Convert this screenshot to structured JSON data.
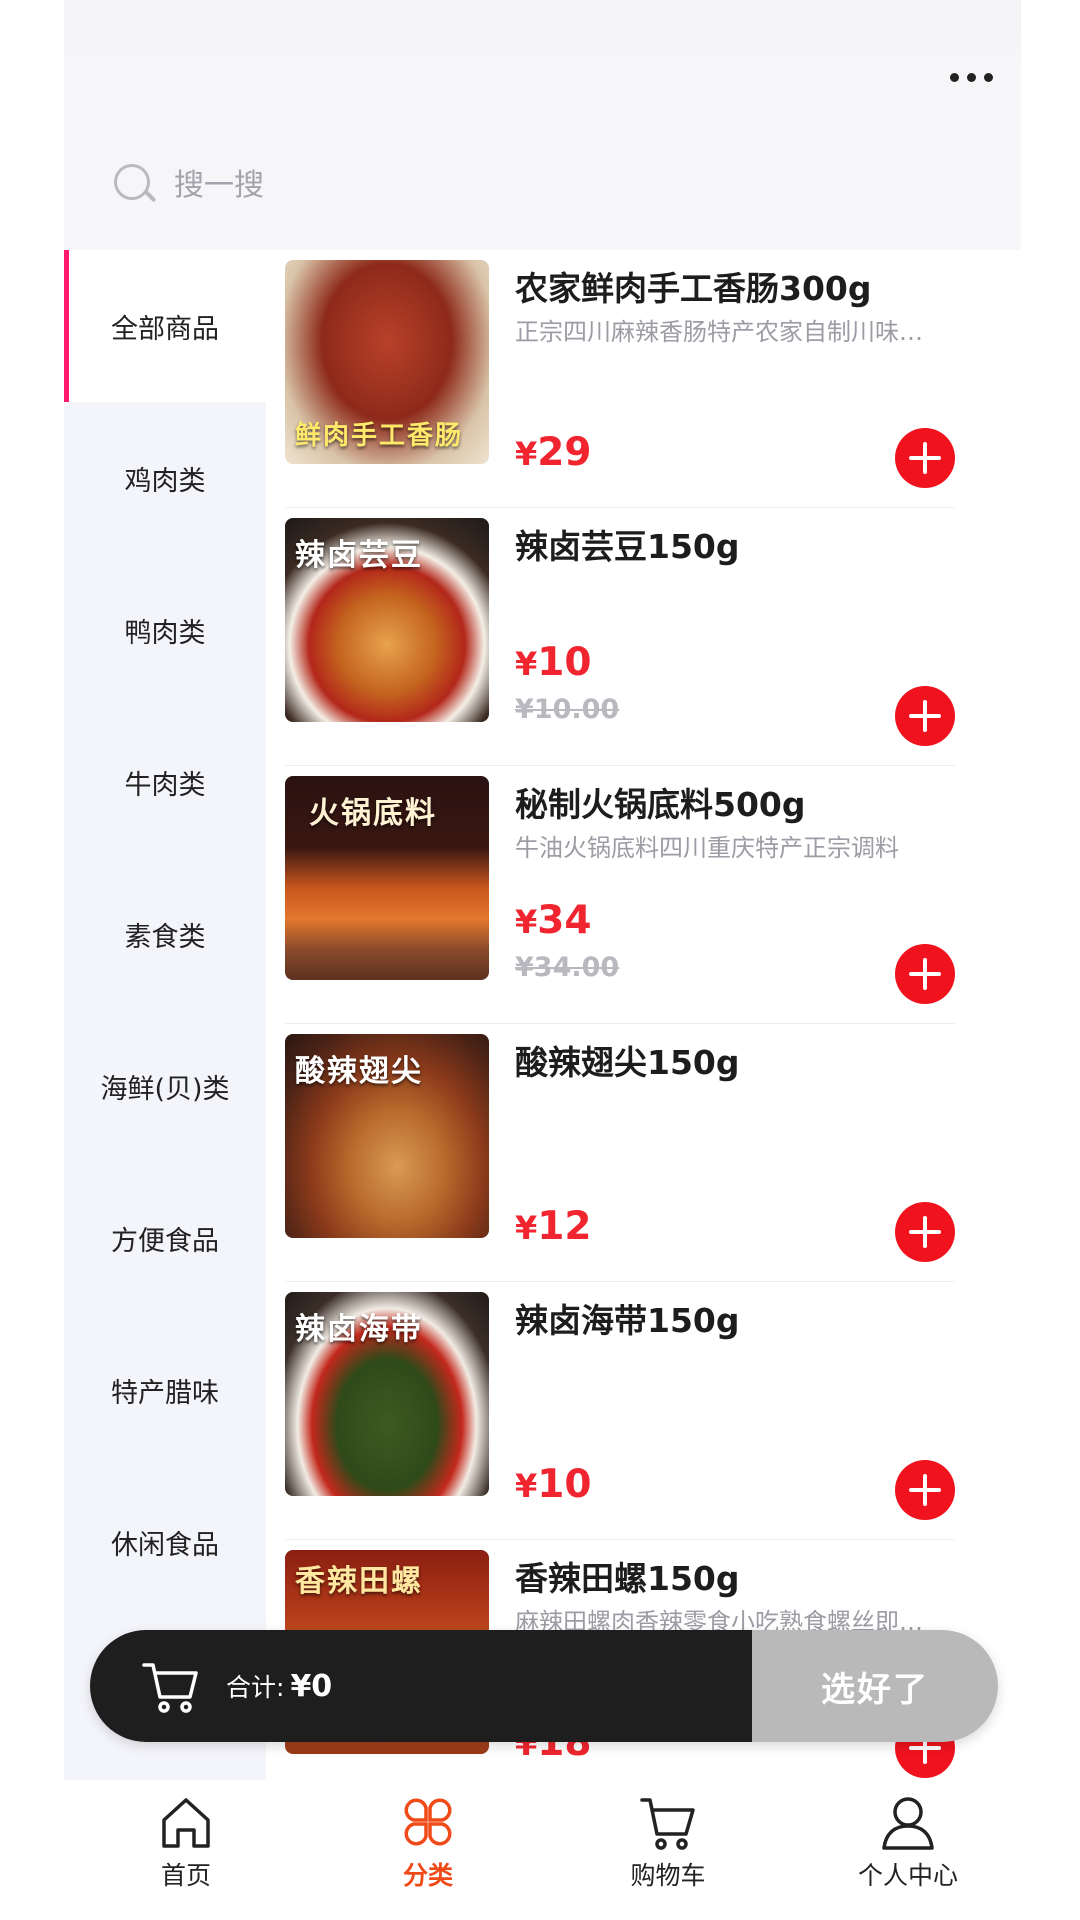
{
  "header": {
    "more_icon": "more-dots-icon",
    "search_icon": "search-icon",
    "search_placeholder": "搜一搜"
  },
  "sidebar": {
    "active_index": 0,
    "items": [
      {
        "label": "全部商品"
      },
      {
        "label": "鸡肉类"
      },
      {
        "label": "鸭肉类"
      },
      {
        "label": "牛肉类"
      },
      {
        "label": "素食类"
      },
      {
        "label": "海鲜(贝)类"
      },
      {
        "label": "方便食品"
      },
      {
        "label": "特产腊味"
      },
      {
        "label": "休闲食品"
      }
    ]
  },
  "products": [
    {
      "image_caption": "鲜肉手工香肠",
      "name": "农家鲜肉手工香肠300g",
      "desc": "正宗四川麻辣香肠特产农家自制川味…",
      "price": "29",
      "original_price": ""
    },
    {
      "image_caption": "辣卤芸豆",
      "name": "辣卤芸豆150g",
      "desc": "",
      "price": "10",
      "original_price": "¥10.00"
    },
    {
      "image_caption": "火锅底料",
      "name": "秘制火锅底料500g",
      "desc": "牛油火锅底料四川重庆特产正宗调料",
      "price": "34",
      "original_price": "¥34.00"
    },
    {
      "image_caption": "酸辣翅尖",
      "name": "酸辣翅尖150g",
      "desc": "",
      "price": "12",
      "original_price": ""
    },
    {
      "image_caption": "辣卤海带",
      "name": "辣卤海带150g",
      "desc": "",
      "price": "10",
      "original_price": ""
    },
    {
      "image_caption": "香辣田螺",
      "name": "香辣田螺150g",
      "desc": "麻辣田螺肉香辣零食小吃熟食螺丝即…",
      "price": "18",
      "original_price": ""
    }
  ],
  "currency_symbol": "¥",
  "cart": {
    "icon": "cart-icon",
    "total_label": "合计:",
    "total_value": "¥0",
    "checkout_label": "选好了"
  },
  "tabbar": {
    "active_index": 1,
    "tabs": [
      {
        "label": "首页",
        "icon": "home-icon"
      },
      {
        "label": "分类",
        "icon": "category-icon"
      },
      {
        "label": "购物车",
        "icon": "cart-icon"
      },
      {
        "label": "个人中心",
        "icon": "user-icon"
      }
    ]
  },
  "colors": {
    "accent_red": "#f0131e",
    "price_red": "#f0252f",
    "sidebar_active_bar": "#ff1a6c",
    "tab_active": "#f04a18",
    "cart_dark": "#1e1e1e",
    "checkout_gray": "#b9b9b9"
  }
}
